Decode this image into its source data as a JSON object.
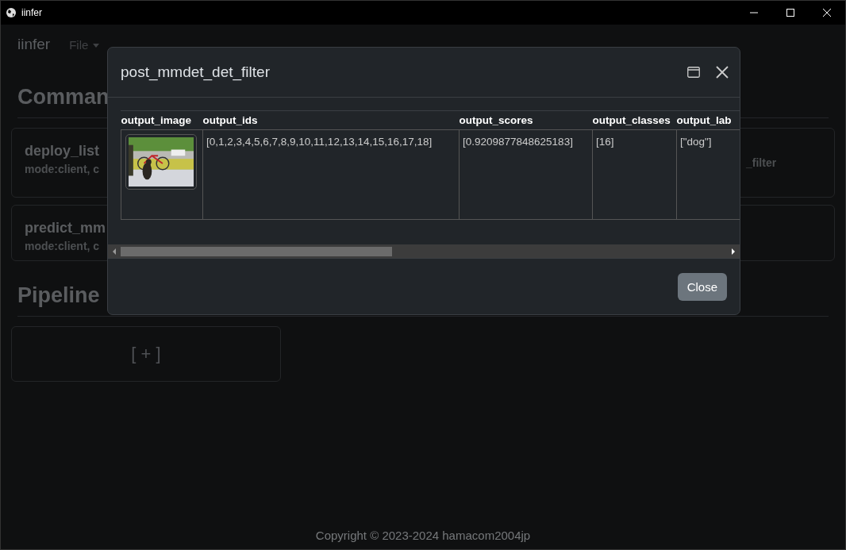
{
  "window": {
    "title": "iinfer"
  },
  "navbar": {
    "brand": "iinfer",
    "menus": [
      {
        "label": "File"
      }
    ]
  },
  "commands": {
    "heading": "Comman",
    "cards": [
      {
        "title": "deploy_list",
        "subtitle": "mode:client, c"
      },
      {
        "subtitle": "_filter"
      },
      {
        "title": "predict_mm",
        "subtitle": "mode:client, c"
      }
    ]
  },
  "pipeline": {
    "heading": "Pipeline",
    "add_label": "[ + ]"
  },
  "footer": "Copyright © 2023-2024 hamacom2004jp",
  "dialog": {
    "title": "post_mmdet_det_filter",
    "table": {
      "columns": [
        "output_image",
        "output_ids",
        "output_scores",
        "output_classes",
        "output_lab"
      ],
      "rows": [
        {
          "cells": [
            {
              "kind": "picture"
            },
            {
              "kind": "text",
              "text": "[0,1,2,3,4,5,6,7,8,9,10,11,12,13,14,15,16,17,18]"
            },
            {
              "kind": "text",
              "text": "[0.9209877848625183]"
            },
            {
              "kind": "text",
              "text": "[16]"
            },
            {
              "kind": "text",
              "text": "[\"dog\"]"
            }
          ]
        }
      ]
    },
    "buttons": [
      "Close"
    ]
  }
}
